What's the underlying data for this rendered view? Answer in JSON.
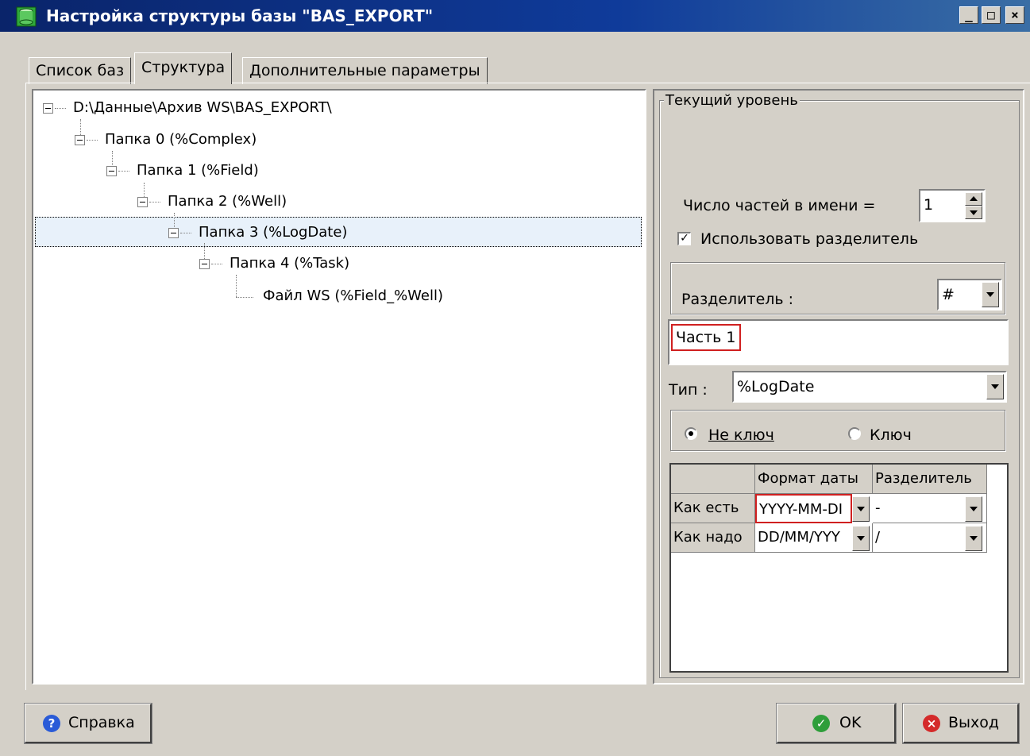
{
  "window": {
    "title": "Настройка структуры базы \"BAS_EXPORT\"",
    "minimize_glyph": "_",
    "maximize_glyph": "□",
    "close_glyph": "×"
  },
  "tabs": [
    {
      "label": "Список баз",
      "active": false
    },
    {
      "label": "Структура",
      "active": true
    },
    {
      "label": "Дополнительные параметры",
      "active": false
    }
  ],
  "tree": {
    "nodes": [
      {
        "label": "D:\\Данные\\Архив WS\\BAS_EXPORT\\",
        "level": 0,
        "expanded": true
      },
      {
        "label": "Папка 0 (%Complex)",
        "level": 1,
        "expanded": true
      },
      {
        "label": "Папка 1 (%Field)",
        "level": 2,
        "expanded": true
      },
      {
        "label": "Папка 2 (%Well)",
        "level": 3,
        "expanded": true
      },
      {
        "label": "Папка 3 (%LogDate)",
        "level": 4,
        "expanded": true,
        "selected": true
      },
      {
        "label": "Папка 4 (%Task)",
        "level": 5,
        "expanded": true
      },
      {
        "label": "Файл WS (%Field_%Well)",
        "level": 6,
        "leaf": true
      }
    ]
  },
  "current_level": {
    "group_title": "Текущий уровень",
    "parts_label": "Число частей в имени =",
    "parts_value": "1",
    "use_separator_label": "Использовать разделитель",
    "use_separator_checked": true,
    "separator_label": "Разделитель :",
    "separator_value": "#",
    "parts_list": [
      "Часть 1"
    ],
    "type_label": "Тип :",
    "type_value": "%LogDate",
    "radio_not_key": "Не ключ",
    "radio_key": "Ключ",
    "selected_radio": "not_key"
  },
  "date_grid": {
    "headers": [
      "",
      "Формат даты",
      "Разделитель"
    ],
    "rows": [
      {
        "name": "Как есть",
        "format": "YYYY-MM-DI",
        "separator": "-"
      },
      {
        "name": "Как надо",
        "format": "DD/MM/YYY",
        "separator": "/"
      }
    ]
  },
  "buttons": {
    "help": "Справка",
    "ok": "OK",
    "exit": "Выход"
  },
  "icons": {
    "app": "database-icon",
    "help": "question-icon",
    "ok": "check-icon",
    "exit": "close-icon"
  },
  "colors": {
    "title_bar": "#0a246a",
    "selection": "#e8f1fa",
    "focus_border": "#d02020",
    "help_icon": "#2a5bd7",
    "ok_icon": "#2e9e3a",
    "exit_icon": "#d42a2a"
  }
}
